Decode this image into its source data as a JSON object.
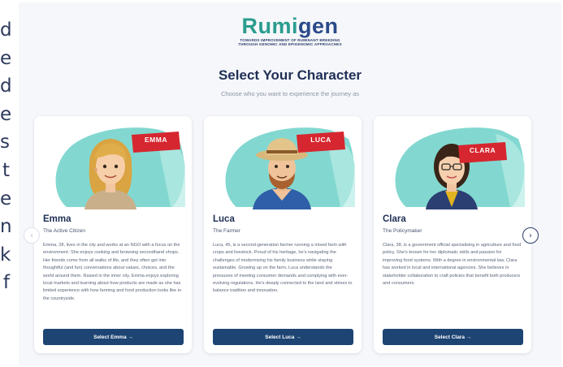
{
  "side_text": [
    "d",
    "e",
    "d",
    "e",
    "s",
    "t",
    "e",
    "n",
    "k",
    "f"
  ],
  "logo": {
    "word_main": "Rumi",
    "word_accent": "gen",
    "tagline_1": "TOWARDS IMPROVEMENT OF RUMINANT BREEDING",
    "tagline_2": "THROUGH GENOMIC AND EPIGENOMIC APPROACHES"
  },
  "header": {
    "title": "Select Your Character",
    "subtitle": "Choose who you want to experience the journey as"
  },
  "characters": [
    {
      "banner": "EMMA",
      "name": "Emma",
      "role": "The Active Citizen",
      "bio": "Emma, 28, lives in the city and works at an NGO with a focus on the environment. She enjoys cooking and browsing secondhand shops. Her friends come from all walks of life, and they often get into thoughtful (and fun) conversations about values, choices, and the world around them. Raised in the inner city, Emma enjoys exploring local markets and learning about how products are made as she has limited experience with how farming and food production looks like in the countryside.",
      "button": "Select Emma →"
    },
    {
      "banner": "LUCA",
      "name": "Luca",
      "role": "The Farmer",
      "bio": "Luca, 45, is a second-generation farmer running a mixed farm with crops and livestock. Proud of his heritage, he's navigating the challenges of modernising his family business while staying sustainable. Growing up on the farm, Luca understands the pressures of meeting consumer demands and complying with ever-evolving regulations. He's deeply connected to the land and strives to balance tradition and innovation.",
      "button": "Select Luca →"
    },
    {
      "banner": "CLARA",
      "name": "Clara",
      "role": "The Policymaker",
      "bio": "Clara, 38, is a government official specialising in agriculture and food policy. She's known for her diplomatic skills and passion for improving food systems. With a degree in environmental law, Clara has worked in local and international agencies. She believes in stakeholder collaboration to craft policies that benefit both producers and consumers.",
      "button": "Select Clara →"
    }
  ],
  "nav": {
    "prev": "‹",
    "next": "›"
  },
  "colors": {
    "navy": "#1d4472",
    "title": "#1f2f55",
    "teal": "#2a9d8f",
    "banner_red": "#d6262f",
    "art_teal": "#7fd6cf"
  }
}
